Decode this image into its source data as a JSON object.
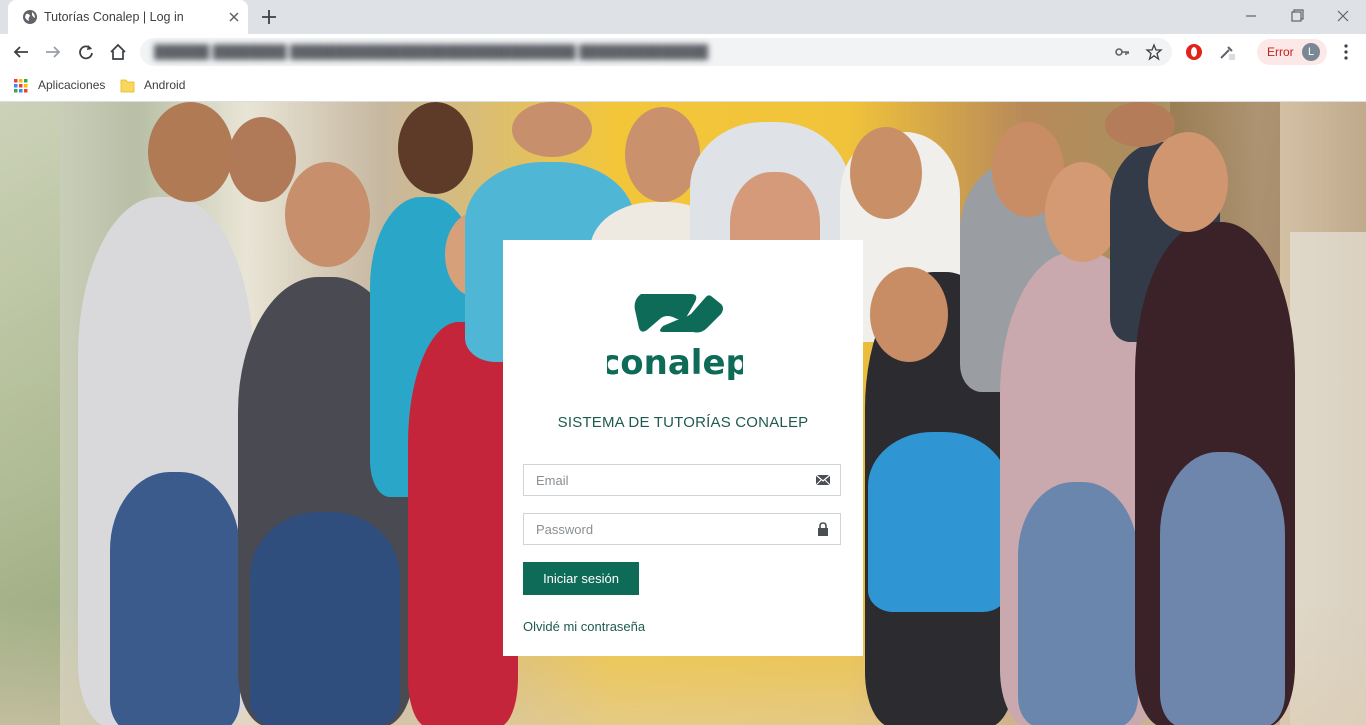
{
  "browser": {
    "tab_title": "Tutorías Conalep | Log in",
    "error_label": "Error",
    "profile_initial": "L",
    "bookmarks": [
      {
        "label": "Aplicaciones",
        "icon": "apps-grid-icon"
      },
      {
        "label": "Android",
        "icon": "folder-icon"
      }
    ]
  },
  "login": {
    "logo_text": "conalep",
    "system_title": "SISTEMA DE TUTORÍAS CONALEP",
    "email_placeholder": "Email",
    "password_placeholder": "Password",
    "submit_label": "Iniciar sesión",
    "forgot_label": "Olvidé mi contraseña"
  },
  "colors": {
    "brand_green": "#0d6b57",
    "title_green": "#1e5a4f",
    "error_red": "#c5221f"
  }
}
